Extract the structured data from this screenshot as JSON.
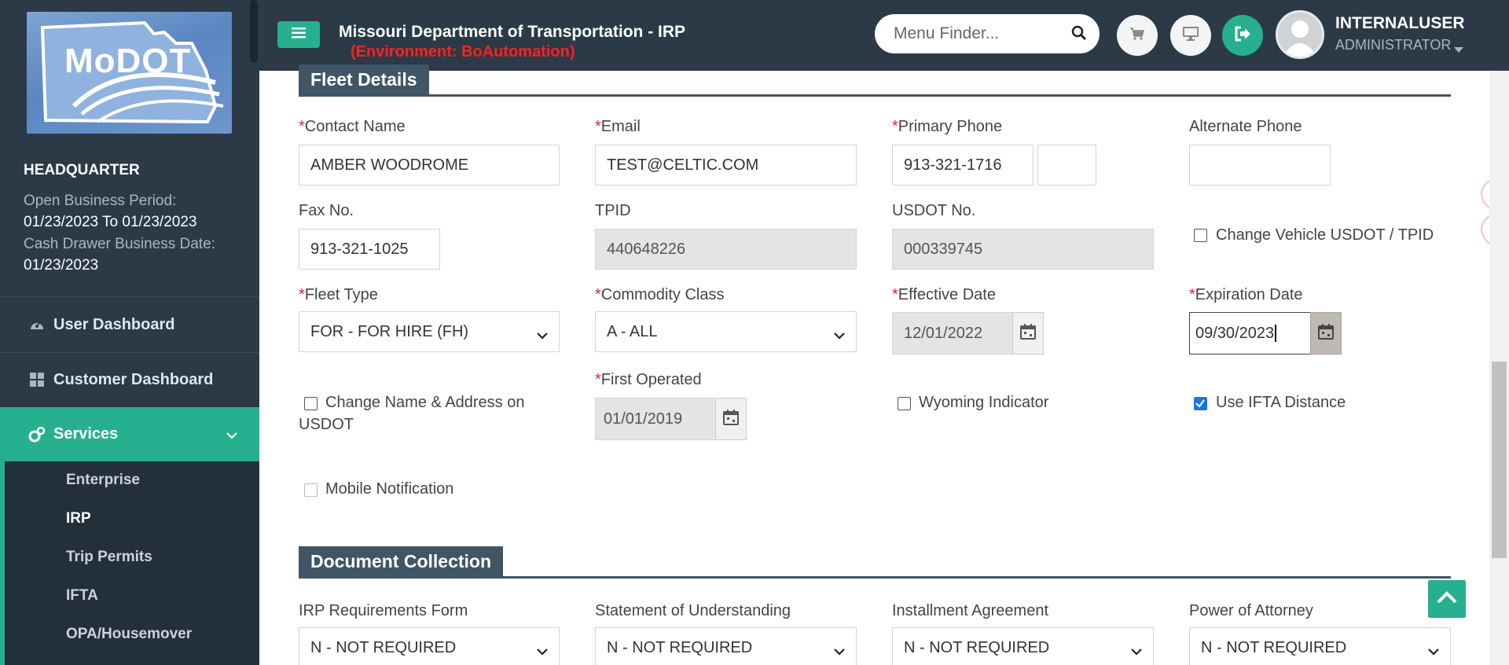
{
  "sidebar": {
    "logo_text": "MoDOT",
    "location": "HEADQUARTER",
    "open_period_label": "Open Business Period:",
    "open_period_value": "01/23/2023 To 01/23/2023",
    "cash_drawer_label": "Cash Drawer Business Date:",
    "cash_drawer_value": "01/23/2023",
    "nav": [
      {
        "label": "User Dashboard",
        "icon": "dashboard-icon"
      },
      {
        "label": "Customer Dashboard",
        "icon": "grid-icon"
      },
      {
        "label": "Services",
        "icon": "gears-icon"
      }
    ],
    "sub_items": [
      "Enterprise",
      "IRP",
      "Trip Permits",
      "IFTA",
      "OPA/Housemover"
    ],
    "accent_color": "#26b08f"
  },
  "header": {
    "title": "Missouri Department of Transportation - IRP",
    "environment": "(Environment: BoAutomation)",
    "search_placeholder": "Menu Finder...",
    "user_name": "INTERNALUSER",
    "user_role": "ADMINISTRATOR"
  },
  "fleet_details": {
    "heading": "Fleet Details",
    "contact_name_label": "Contact Name",
    "contact_name_value": "AMBER WOODROME",
    "email_label": "Email",
    "email_value": "TEST@CELTIC.COM",
    "primary_phone_label": "Primary Phone",
    "primary_phone_value": "913-321-1716",
    "primary_phone_ext": "",
    "alternate_phone_label": "Alternate Phone",
    "alternate_phone_value": "",
    "fax_label": "Fax No.",
    "fax_value": "913-321-1025",
    "tpid_label": "TPID",
    "tpid_value": "440648226",
    "usdot_label": "USDOT No.",
    "usdot_value": "000339745",
    "change_usdot_label": "Change Vehicle USDOT / TPID",
    "fleet_type_label": "Fleet Type",
    "fleet_type_value": "FOR - FOR HIRE (FH)",
    "commodity_label": "Commodity Class",
    "commodity_value": "A - ALL",
    "effective_label": "Effective Date",
    "effective_value": "12/01/2022",
    "expiration_label": "Expiration Date",
    "expiration_value": "09/30/2023",
    "change_name_label_1": "Change Name & Address on",
    "change_name_label_2": "USDOT",
    "first_operated_label": "First Operated",
    "first_operated_value": "01/01/2019",
    "wyoming_label": "Wyoming Indicator",
    "ifta_label": "Use IFTA Distance",
    "ifta_checked": true,
    "mobile_label": "Mobile Notification"
  },
  "document_collection": {
    "heading": "Document Collection",
    "items": [
      {
        "label": "IRP Requirements Form",
        "value": "N - NOT REQUIRED"
      },
      {
        "label": "Statement of Understanding",
        "value": "N - NOT REQUIRED"
      },
      {
        "label": "Installment Agreement",
        "value": "N - NOT REQUIRED"
      },
      {
        "label": "Power of Attorney",
        "value": "N - NOT REQUIRED"
      }
    ]
  }
}
